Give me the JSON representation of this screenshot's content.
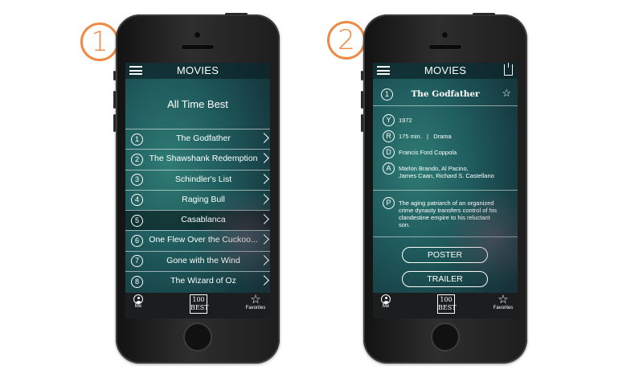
{
  "steps": [
    "1",
    "2"
  ],
  "screen1": {
    "title": "MOVIES",
    "heading": "All Time Best",
    "movies": [
      {
        "num": "1",
        "title": "The Godfather"
      },
      {
        "num": "2",
        "title": "The Shawshank Redemption"
      },
      {
        "num": "3",
        "title": "Schindler's List"
      },
      {
        "num": "4",
        "title": "Raging Bull"
      },
      {
        "num": "5",
        "title": "Casablanca"
      },
      {
        "num": "6",
        "title": "One Flew Over the Cuckoo..."
      },
      {
        "num": "7",
        "title": "Gone with the Wind"
      },
      {
        "num": "8",
        "title": "The Wizard of Oz"
      }
    ],
    "active_index": 4
  },
  "screen2": {
    "title": "MOVIES",
    "rank": "1",
    "movie_title": "The Godfather",
    "year_key": "Y",
    "year": "1972",
    "runtime_key": "R",
    "runtime": "175 min.   |   Drama",
    "director_key": "D",
    "director": "Francis Ford Coppola",
    "actors_key": "A",
    "actors_line1": "Marlon Brando, Al Pacino,",
    "actors_line2": "James Caan, Richard S. Castellano",
    "plot_key": "P",
    "plot_lines": [
      "The aging patriarch of an organized",
      "crime dynasty transfers control of his",
      "clandestine empire to his reluctant",
      "son."
    ],
    "poster_button": "POSTER",
    "trailer_button": "TRAILER"
  },
  "tabbar": {
    "me_label": "Me",
    "logo_line1": "100",
    "logo_line2": "BEST",
    "favorites_label": "Favorites"
  },
  "colors": {
    "badge": "#ee8a43",
    "screen_teal": "#2f7b75",
    "tabbar": "#1b1d1e"
  },
  "icons": [
    "menu-icon",
    "share-icon",
    "star-icon",
    "person-icon",
    "chevron-right-icon"
  ]
}
